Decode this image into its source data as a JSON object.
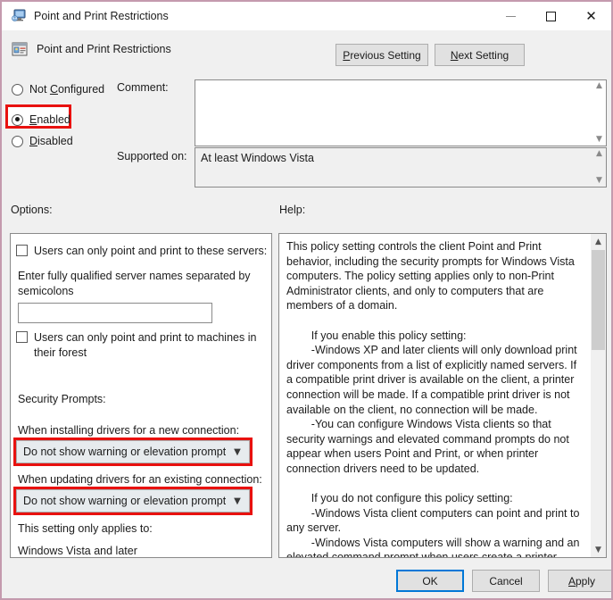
{
  "window": {
    "title": "Point and Print Restrictions",
    "icon": "policy-computer-icon",
    "controls": {
      "minimize": "minimize-icon",
      "maximize": "maximize-icon",
      "close": "close-icon"
    }
  },
  "header": {
    "icon": "policy-setting-icon",
    "title": "Point and Print Restrictions",
    "previous_setting": "Previous Setting",
    "previous_setting_accel": "P",
    "next_setting": "Next Setting",
    "next_setting_accel": "N"
  },
  "state": {
    "options": [
      {
        "label": "Not Configured",
        "accel": "C",
        "selected": false
      },
      {
        "label": "Enabled",
        "accel": "E",
        "selected": true
      },
      {
        "label": "Disabled",
        "accel": "D",
        "selected": false
      }
    ]
  },
  "comment": {
    "label": "Comment:",
    "value": "",
    "placeholder": ""
  },
  "supported_on": {
    "label": "Supported on:",
    "value": "At least Windows Vista"
  },
  "panels": {
    "options_label": "Options:",
    "help_label": "Help:"
  },
  "options": {
    "checkbox_servers": {
      "label": "Users can only point and print to these servers:",
      "checked": false
    },
    "servers_description": "Enter fully qualified server names separated by semicolons",
    "servers_input_value": "",
    "checkbox_forest": {
      "label": "Users can only point and print to machines in their forest",
      "checked": false
    },
    "security_prompts_label": "Security Prompts:",
    "install_label": "When installing drivers for a new connection:",
    "install_value": "Do not show warning or elevation prompt",
    "update_label": "When updating drivers for an existing connection:",
    "update_value": "Do not show warning or elevation prompt",
    "applies_to_label": "This setting only applies to:",
    "applies_to_value": "Windows Vista and later"
  },
  "help": {
    "text": "This policy setting controls the client Point and Print behavior, including the security prompts for Windows Vista computers. The policy setting applies only to non-Print Administrator clients, and only to computers that are members of a domain.\n\n        If you enable this policy setting:\n        -Windows XP and later clients will only download print driver components from a list of explicitly named servers. If a compatible print driver is available on the client, a printer connection will be made. If a compatible print driver is not available on the client, no connection will be made.\n        -You can configure Windows Vista clients so that security warnings and elevated command prompts do not appear when users Point and Print, or when printer connection drivers need to be updated.\n\n        If you do not configure this policy setting:\n        -Windows Vista client computers can point and print to any server.\n        -Windows Vista computers will show a warning and an elevated command prompt when users create a printer connection to any server using Point and Print.\n        -Windows Vista computers will show a warning and an"
  },
  "footer": {
    "ok": "OK",
    "cancel": "Cancel",
    "apply": "Apply",
    "apply_accel": "A"
  },
  "highlights": {
    "color": "#e8110f",
    "targets": [
      "enabled-radio",
      "install-driver-dropdown",
      "update-driver-dropdown"
    ]
  }
}
